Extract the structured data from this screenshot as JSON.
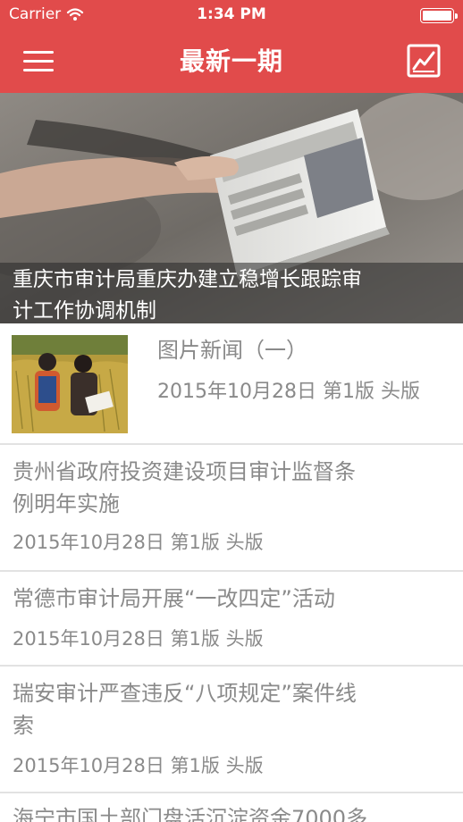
{
  "status_bar": {
    "carrier": "Carrier",
    "time": "1:34 PM",
    "battery_level": 1.0
  },
  "header": {
    "title": "最新一期",
    "menu_icon": "hamburger-menu-icon",
    "chart_icon": "line-chart-icon",
    "background_color": "#e14b4b"
  },
  "featured": {
    "title_line1": "重庆市审计局重庆办建立稳增长跟踪审",
    "title_line2": "计工作协调机制"
  },
  "articles": [
    {
      "title": "图片新闻（一）",
      "meta": "2015年10月28日  第1版 头版",
      "has_thumbnail": true
    },
    {
      "title_line1": "贵州省政府投资建设项目审计监督条",
      "title_line2": "例明年实施",
      "meta": "2015年10月28日 第1版 头版"
    },
    {
      "title": "常德市审计局开展“一改四定”活动",
      "meta": "2015年10月28日 第1版 头版"
    },
    {
      "title_line1": "瑞安审计严查违反“八项规定”案件线",
      "title_line2": "索",
      "meta": "2015年10月28日 第1版 头版"
    },
    {
      "title": "海宁市国土部门盘活沉淀资金7000多"
    }
  ]
}
